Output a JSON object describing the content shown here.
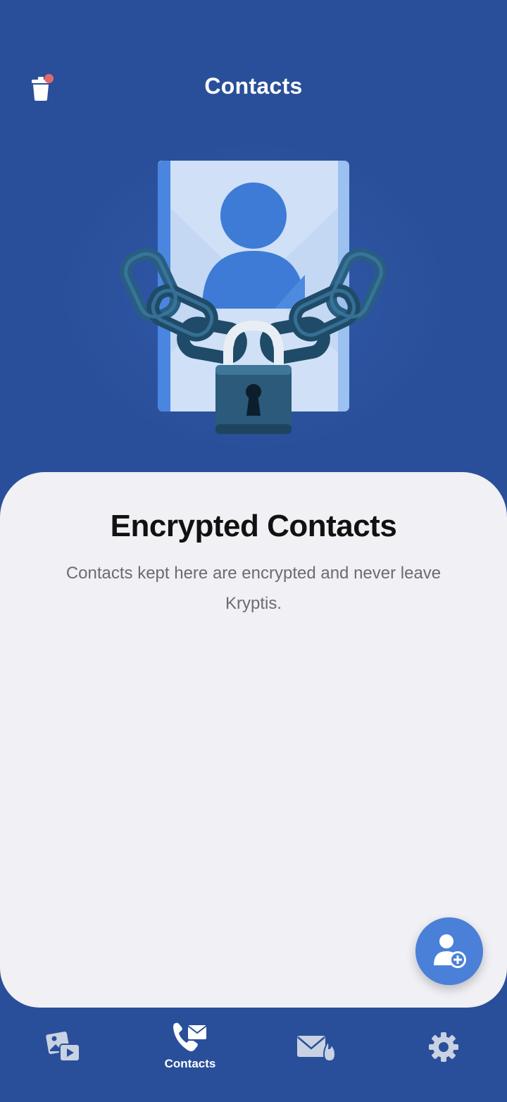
{
  "header": {
    "title": "Contacts",
    "trash_icon": "trash-icon",
    "badge_color": "#e06a6a"
  },
  "hero": {
    "illustration": "locked-contact-card-illustration"
  },
  "content": {
    "heading": "Encrypted Contacts",
    "description": "Contacts kept here are encrypted and never leave Kryptis."
  },
  "fab": {
    "icon": "add-contact-icon"
  },
  "tabbar": {
    "tabs": [
      {
        "icon": "media-vault-icon",
        "label": ""
      },
      {
        "icon": "contacts-icon",
        "label": "Contacts",
        "active": true
      },
      {
        "icon": "burn-mail-icon",
        "label": ""
      },
      {
        "icon": "settings-gear-icon",
        "label": ""
      }
    ]
  },
  "colors": {
    "background": "#2a4f9a",
    "sheet": "#f0f0f5",
    "accent": "#4a80d8",
    "inactive_tab": "#c9d2e3"
  }
}
